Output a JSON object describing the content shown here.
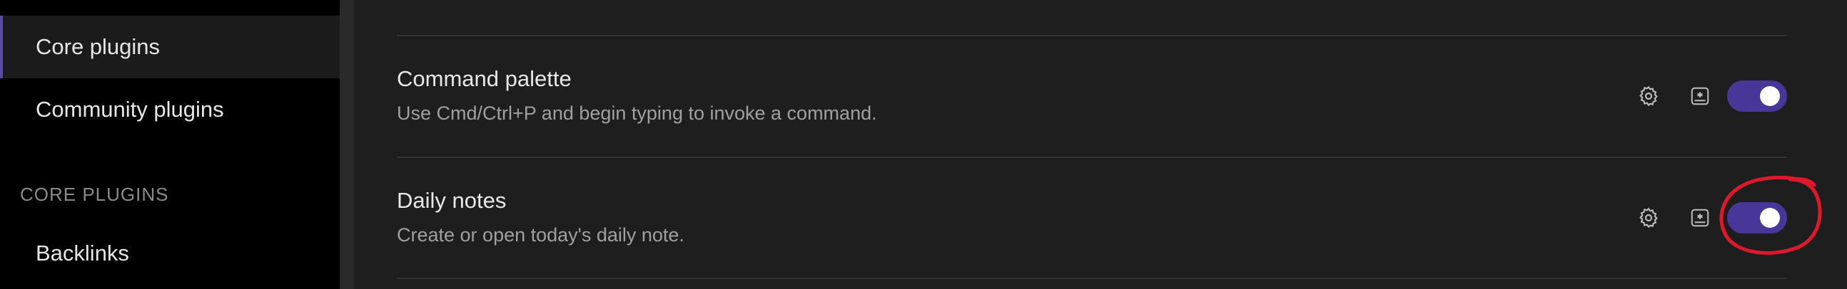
{
  "sidebar": {
    "items": [
      {
        "label": "Core plugins",
        "active": true
      },
      {
        "label": "Community plugins",
        "active": false
      }
    ],
    "section_heading": "CORE PLUGINS",
    "section_items": [
      {
        "label": "Backlinks"
      }
    ]
  },
  "main": {
    "settings": [
      {
        "name": "Command palette",
        "description": "Use Cmd/Ctrl+P and begin typing to invoke a command.",
        "enabled": true
      },
      {
        "name": "Daily notes",
        "description": "Create or open today's daily note.",
        "enabled": true
      }
    ]
  },
  "colors": {
    "accent": "#483699",
    "annotation": "#e0182b"
  },
  "icons": {
    "settings": "gear-icon",
    "hotkeys": "hotkey-icon"
  }
}
